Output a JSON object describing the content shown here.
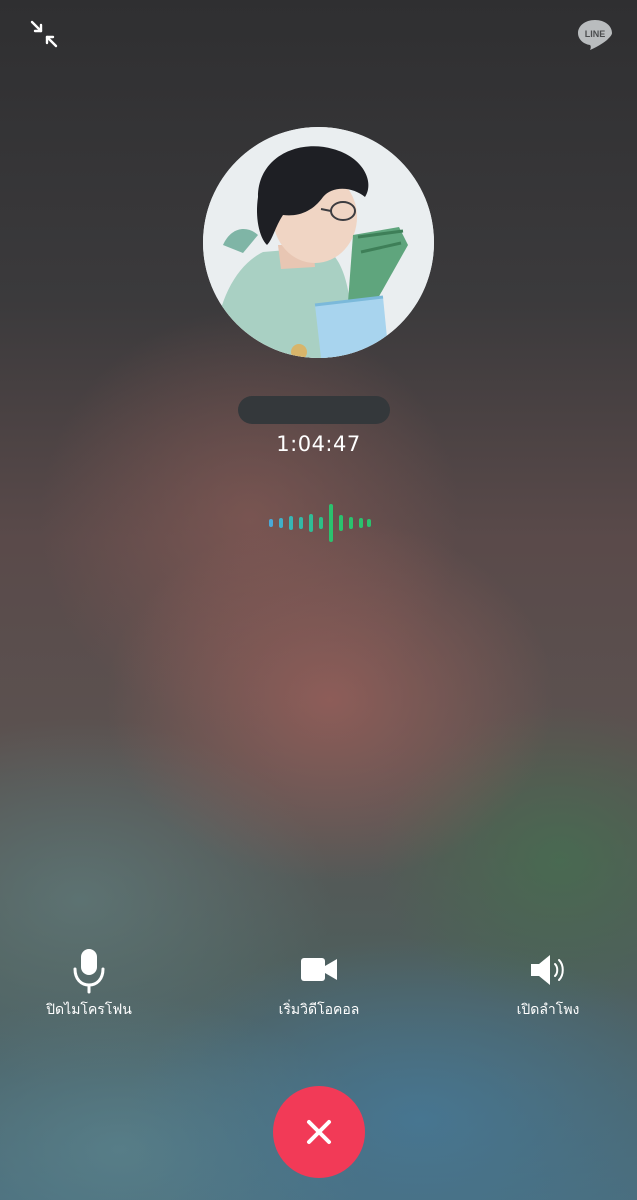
{
  "header": {
    "minimize_icon": "collapse-arrows-icon",
    "logo_text": "LINE"
  },
  "call": {
    "contact_name": "",
    "duration": "1:04:47",
    "voice_indicator_icon": "audio-waveform-icon"
  },
  "controls": [
    {
      "id": "mute",
      "icon": "microphone-icon",
      "label": "ปิดไมโครโฟน"
    },
    {
      "id": "video",
      "icon": "video-camera-icon",
      "label": "เริ่มวิดีโอคอล"
    },
    {
      "id": "speaker",
      "icon": "speaker-icon",
      "label": "เปิดลำโพง"
    }
  ],
  "end_call": {
    "icon": "close-x-icon"
  },
  "colors": {
    "end_call": "#f23a57",
    "wave_green": "#2bc26e",
    "wave_blue": "#4aa9d8",
    "text": "#ffffff"
  }
}
